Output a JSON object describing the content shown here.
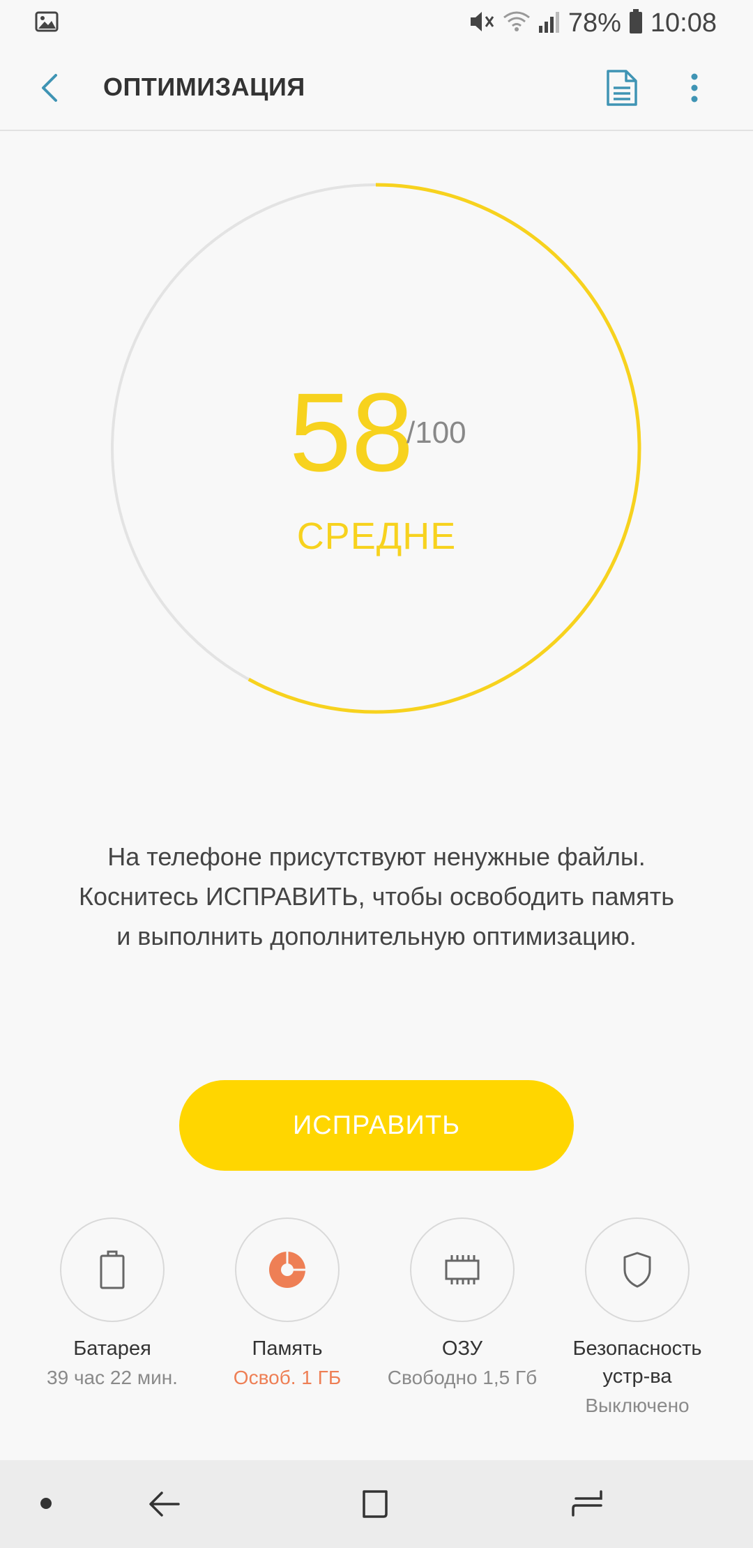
{
  "status_bar": {
    "battery_percent": "78%",
    "time": "10:08",
    "icons": [
      "image-notification-icon",
      "mute-icon",
      "wifi-icon",
      "signal-icon",
      "battery-icon"
    ]
  },
  "app_bar": {
    "title": "ОПТИМИЗАЦИЯ",
    "icons": [
      "back-icon",
      "report-icon",
      "more-options-icon"
    ]
  },
  "score": {
    "value": "58",
    "max": "/100",
    "label": "СРЕДНЕ",
    "fraction": 0.58,
    "color": "#f7d21e",
    "track_color": "#e3e3e3"
  },
  "message": {
    "line1": "На телефоне присутствуют ненужные файлы.",
    "line2": "Коснитесь ИСПРАВИТЬ, чтобы освободить память",
    "line3": "и выполнить дополнительную оптимизацию."
  },
  "fix_button": {
    "label": "ИСПРАВИТЬ",
    "color": "#ffd600"
  },
  "items": [
    {
      "label": "Батарея",
      "status": "39 час 22 мин.",
      "icon": "battery-icon"
    },
    {
      "label": "Память",
      "status": "Освоб. 1 ГБ",
      "icon": "storage-pie-icon",
      "status_color": "#ee7f55"
    },
    {
      "label": "ОЗУ",
      "status": "Свободно 1,5 Гб",
      "icon": "memory-chip-icon"
    },
    {
      "label_line1": "Безопасность",
      "label_line2": "устр-ва",
      "status": "Выключено",
      "icon": "shield-icon"
    }
  ],
  "nav_bar": {
    "icons": [
      "dot-icon",
      "back-arrow-icon",
      "home-square-icon",
      "recents-icon"
    ]
  }
}
